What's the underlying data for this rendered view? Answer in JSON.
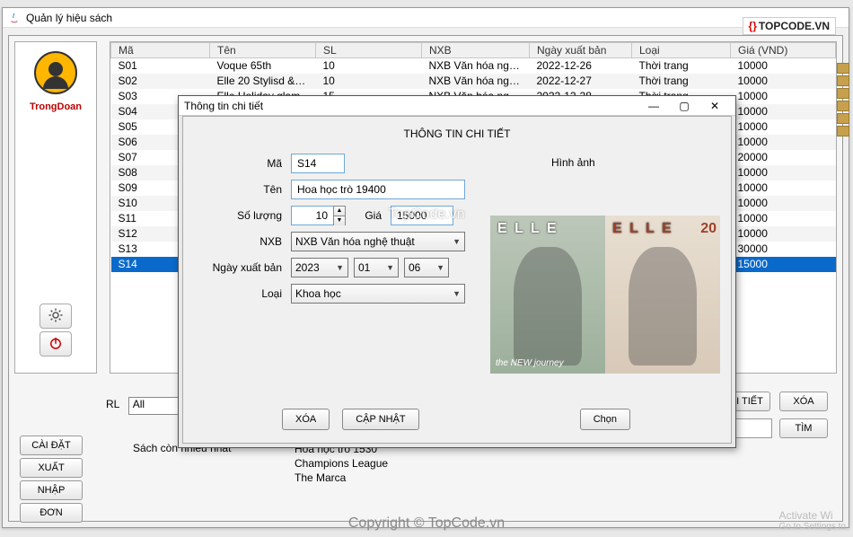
{
  "app": {
    "title": "Quản lý hiệu sách",
    "logo_left": "{}",
    "logo_text": "TOPCODE.VN"
  },
  "sidebar": {
    "username": "TrongDoan"
  },
  "table": {
    "cols": [
      "Mã",
      "Tên",
      "SL",
      "NXB",
      "Ngày xuất bản",
      "Loại",
      "Giá (VND)"
    ],
    "rows": [
      {
        "ma": "S01",
        "ten": "Voque 65th",
        "sl": "10",
        "nxb": "NXB Văn hóa ngh…",
        "ngay": "2022-12-26",
        "loai": "Thời trang",
        "gia": "10000"
      },
      {
        "ma": "S02",
        "ten": "Elle 20 Stylisd & c…",
        "sl": "10",
        "nxb": "NXB Văn hóa ngh…",
        "ngay": "2022-12-27",
        "loai": "Thời trang",
        "gia": "10000"
      },
      {
        "ma": "S03",
        "ten": "Elle Holiday glam",
        "sl": "15",
        "nxb": "NXB Văn hóa ngh…",
        "ngay": "2022-12-28",
        "loai": "Thời trang",
        "gia": "10000"
      },
      {
        "ma": "S04",
        "ten": "",
        "sl": "",
        "nxb": "",
        "ngay": "",
        "loai": "",
        "gia": "10000"
      },
      {
        "ma": "S05",
        "ten": "",
        "sl": "",
        "nxb": "",
        "ngay": "",
        "loai": "",
        "gia": "10000"
      },
      {
        "ma": "S06",
        "ten": "",
        "sl": "",
        "nxb": "",
        "ngay": "",
        "loai": "",
        "gia": "10000"
      },
      {
        "ma": "S07",
        "ten": "",
        "sl": "",
        "nxb": "",
        "ngay": "",
        "loai": "",
        "gia": "20000"
      },
      {
        "ma": "S08",
        "ten": "",
        "sl": "",
        "nxb": "",
        "ngay": "",
        "loai": "",
        "gia": "10000"
      },
      {
        "ma": "S09",
        "ten": "",
        "sl": "",
        "nxb": "",
        "ngay": "",
        "loai": "",
        "gia": "10000"
      },
      {
        "ma": "S10",
        "ten": "",
        "sl": "",
        "nxb": "",
        "ngay": "",
        "loai": "",
        "gia": "10000"
      },
      {
        "ma": "S11",
        "ten": "",
        "sl": "",
        "nxb": "",
        "ngay": "",
        "loai": "",
        "gia": "10000"
      },
      {
        "ma": "S12",
        "ten": "",
        "sl": "",
        "nxb": "",
        "ngay": "",
        "loai": "",
        "gia": "10000"
      },
      {
        "ma": "S13",
        "ten": "",
        "sl": "",
        "nxb": "",
        "ngay": "",
        "loai": "",
        "gia": "30000"
      },
      {
        "ma": "S14",
        "ten": "",
        "sl": "",
        "nxb": "",
        "ngay": "",
        "loai": "",
        "gia": "15000"
      }
    ],
    "selected": "S14"
  },
  "filter": {
    "label": "RL",
    "value": "All"
  },
  "buttons": {
    "caidat": "CÀI ĐẶT",
    "xuat": "XUẤT",
    "nhap": "NHẬP",
    "don": "ĐƠN",
    "chitiet": "HI TIẾT",
    "xoa": "XÓA",
    "tim": "TÌM"
  },
  "sachcon": {
    "label": "Sách còn nhieu nhat",
    "items": [
      "Hoa học trò 1530",
      "Champions League",
      "The Marca"
    ]
  },
  "dialog": {
    "title": "Thông tin chi tiết",
    "heading": "THÔNG TIN CHI TIẾT",
    "labels": {
      "ma": "Mã",
      "ten": "Tên",
      "sl": "Số lượng",
      "gia": "Giá",
      "nxb": "NXB",
      "ngay": "Ngày xuất bản",
      "loai": "Loại",
      "hinhanh": "Hình ảnh"
    },
    "values": {
      "ma": "S14",
      "ten": "Hoa học trò 19400",
      "sl": "10",
      "gia": "15000",
      "nxb": "NXB Văn hóa nghệ thuật",
      "year": "2023",
      "month": "01",
      "day": "06",
      "loai": "Khoa học"
    },
    "btn_xoa": "XÓA",
    "btn_capnhat": "CẬP NHẬT",
    "btn_chon": "Chọn"
  },
  "watermarks": {
    "mid": "TopCode.vn",
    "bottom": "Copyright © TopCode.vn",
    "activate": "Activate Wi",
    "activate2": "Go to Settings to"
  }
}
